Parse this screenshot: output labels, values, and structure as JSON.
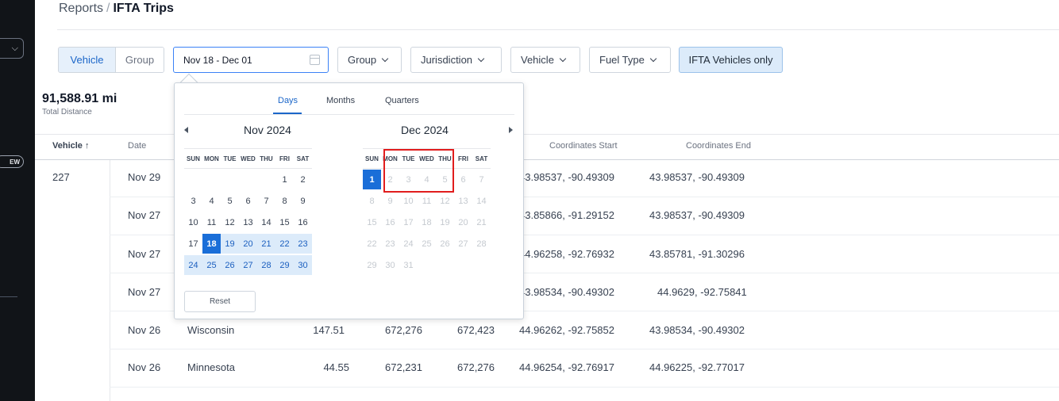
{
  "sidebar": {
    "button_label": "⌵",
    "pill_label": "EW"
  },
  "breadcrumb": {
    "parent": "Reports",
    "separator": "/",
    "current": "IFTA Trips"
  },
  "filters": {
    "view_toggle": {
      "vehicle": "Vehicle",
      "group": "Group",
      "selected": "Vehicle"
    },
    "date_range": "Nov 18 - Dec 01",
    "group": "Group",
    "jurisdiction": "Jurisdiction",
    "vehicle": "Vehicle",
    "fuel_type": "Fuel Type",
    "ifta_only": "IFTA Vehicles only"
  },
  "summary": {
    "total_distance": "91,588.91 mi",
    "total_distance_label": "Total Distance"
  },
  "table": {
    "headers": {
      "vehicle": "Vehicle ↑",
      "date": "Date",
      "coordinates_start": "Coordinates Start",
      "coordinates_end": "Coordinates End"
    },
    "vehicle_group": "227",
    "rows": [
      {
        "date": "Nov 29",
        "jurisdiction": "",
        "distance": "",
        "odo_start": "",
        "odo_end": "",
        "coord_start": "43.98537, -90.49309",
        "coord_end": "43.98537, -90.49309"
      },
      {
        "date": "Nov 27",
        "jurisdiction": "",
        "distance": "",
        "odo_start": "",
        "odo_end": "",
        "coord_start": "43.85866, -91.29152",
        "coord_end": "43.98537, -90.49309"
      },
      {
        "date": "Nov 27",
        "jurisdiction": "",
        "distance": "",
        "odo_start": "",
        "odo_end": "",
        "coord_start": "44.96258, -92.76932",
        "coord_end": "43.85781, -91.30296"
      },
      {
        "date": "Nov 27",
        "jurisdiction": "",
        "distance": "",
        "odo_start": "",
        "odo_end": "",
        "coord_start": "43.98534, -90.49302",
        "coord_end": "44.9629, -92.75841"
      },
      {
        "date": "Nov 26",
        "jurisdiction": "Wisconsin",
        "distance": "147.51",
        "odo_start": "672,276",
        "odo_end": "672,423",
        "coord_start": "44.96262, -92.75852",
        "coord_end": "43.98534, -90.49302"
      },
      {
        "date": "Nov 26",
        "jurisdiction": "Minnesota",
        "distance": "44.55",
        "odo_start": "672,231",
        "odo_end": "672,276",
        "coord_start": "44.96254, -92.76917",
        "coord_end": "44.96225, -92.77017"
      }
    ]
  },
  "datepicker": {
    "tabs": [
      "Days",
      "Months",
      "Quarters"
    ],
    "active_tab": "Days",
    "left_month": "Nov 2024",
    "right_month": "Dec 2024",
    "dow": [
      "SUN",
      "MON",
      "TUE",
      "WED",
      "THU",
      "FRI",
      "SAT"
    ],
    "reset_label": "Reset",
    "nov_weeks": [
      [
        null,
        null,
        null,
        null,
        null,
        "1",
        "2"
      ],
      [
        "3",
        "4",
        "5",
        "6",
        "7",
        "8",
        "9"
      ],
      [
        "10",
        "11",
        "12",
        "13",
        "14",
        "15",
        "16"
      ],
      [
        "17",
        "18",
        "19",
        "20",
        "21",
        "22",
        "23"
      ],
      [
        "24",
        "25",
        "26",
        "27",
        "28",
        "29",
        "30"
      ]
    ],
    "dec_weeks": [
      [
        "1",
        "2",
        "3",
        "4",
        "5",
        "6",
        "7"
      ],
      [
        "8",
        "9",
        "10",
        "11",
        "12",
        "13",
        "14"
      ],
      [
        "15",
        "16",
        "17",
        "18",
        "19",
        "20",
        "21"
      ],
      [
        "22",
        "23",
        "24",
        "25",
        "26",
        "27",
        "28"
      ],
      [
        "29",
        "30",
        "31",
        null,
        null,
        null,
        null
      ]
    ],
    "range_start": "Nov 18",
    "range_end": "Dec 01"
  },
  "colors": {
    "accent": "#1a6ed8",
    "range": "#dcebfa",
    "highlight": "#e11d1d",
    "sidebar": "#111418"
  }
}
